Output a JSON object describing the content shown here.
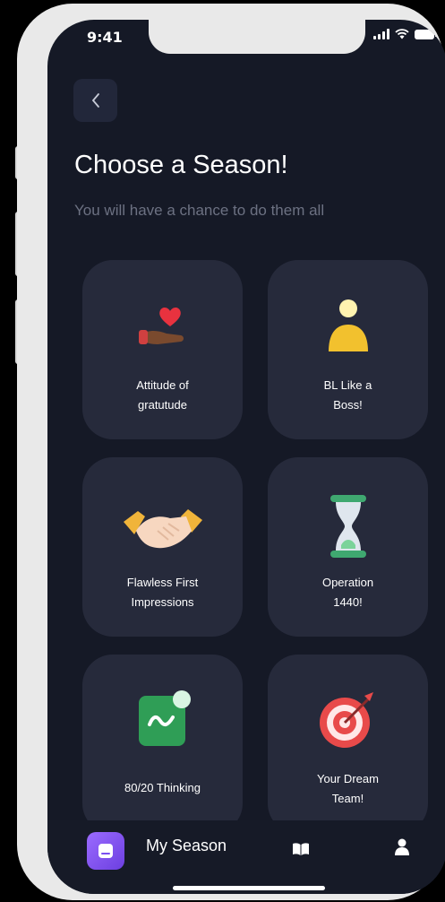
{
  "status_bar": {
    "time": "9:41"
  },
  "header": {
    "title": "Choose a Season!",
    "subtitle": "You will have a chance to do them all"
  },
  "seasons": [
    {
      "label": "Attitude of\ngratutude",
      "icon": "heart-hand-icon"
    },
    {
      "label": "BL Like a\nBoss!",
      "icon": "person-icon"
    },
    {
      "label": "Flawless First\nImpressions",
      "icon": "handshake-icon"
    },
    {
      "label": "Operation\n1440!",
      "icon": "hourglass-icon"
    },
    {
      "label": "80/20 Thinking",
      "icon": "app-badge-icon"
    },
    {
      "label": "Your Dream\nTeam!",
      "icon": "target-icon"
    }
  ],
  "tab_bar": {
    "active_label": "My Season",
    "items": [
      "season-icon",
      "book-icon",
      "user-icon"
    ]
  },
  "colors": {
    "background": "#151926",
    "card": "#262a3b",
    "accent": "#8b5cf6"
  }
}
